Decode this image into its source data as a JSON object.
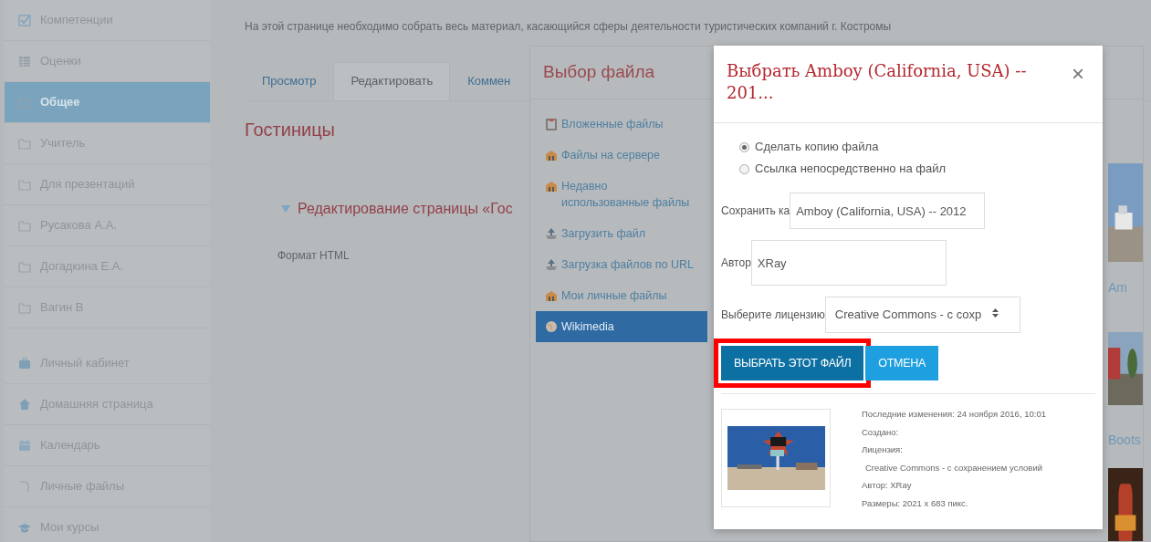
{
  "sidebar": {
    "course_items": [
      {
        "label": "Компетенции",
        "selected": false
      },
      {
        "label": "Оценки",
        "selected": false
      },
      {
        "label": "Общее",
        "selected": true
      },
      {
        "label": "Учитель",
        "selected": false
      },
      {
        "label": "Для презентаций",
        "selected": false
      },
      {
        "label": "Русакова А.А.",
        "selected": false
      },
      {
        "label": "Догадкина Е.А.",
        "selected": false
      },
      {
        "label": "Вагин В",
        "selected": false
      }
    ],
    "nav_items": [
      {
        "label": "Личный кабинет",
        "selected": false
      },
      {
        "label": "Домашняя страница",
        "selected": false
      },
      {
        "label": "Календарь",
        "selected": false
      },
      {
        "label": "Личные файлы",
        "selected": false
      },
      {
        "label": "Мои курсы",
        "selected": false
      }
    ]
  },
  "page": {
    "intro": "На этой странице необходимо собрать весь материал, касающийся сферы деятельности туристических компаний г. Костромы",
    "tabs": [
      {
        "label": "Просмотр",
        "selected": false
      },
      {
        "label": "Редактировать",
        "selected": true
      },
      {
        "label": "Коммен",
        "selected": false
      }
    ],
    "heading": "Гостиницы",
    "section": {
      "title": "Редактирование страницы «Гос",
      "expanded": true
    },
    "format_label": "Формат HTML"
  },
  "file_picker": {
    "title": "Выбор файла",
    "repositories": [
      {
        "label": "Вложенные файлы",
        "selected": false
      },
      {
        "label": "Файлы на сервере",
        "selected": false
      },
      {
        "label": "Недавно использованные файлы",
        "selected": false
      },
      {
        "label": "Загрузить файл",
        "selected": false
      },
      {
        "label": "Загрузка файлов по URL",
        "selected": false
      },
      {
        "label": "Мои личные файлы",
        "selected": false
      },
      {
        "label": "Wikimedia",
        "selected": true
      }
    ],
    "results": [
      {
        "label": "Am"
      },
      {
        "label": "Boots"
      }
    ]
  },
  "select_dialog": {
    "title": "Выбрать Amboy (California, USA) -- 201...",
    "close_label": "×",
    "options": [
      {
        "label": "Сделать копию файла",
        "selected": true
      },
      {
        "label": "Ссылка непосредственно на файл",
        "selected": false
      }
    ],
    "save_as": {
      "label": "Сохранить ка",
      "value": "Amboy (California, USA) -- 2012"
    },
    "author": {
      "label": "Автор",
      "value": "XRay"
    },
    "license": {
      "label": "Выберите лицензию",
      "value": "Creative Commons - с сохр"
    },
    "buttons": [
      {
        "label": "ВЫБРАТЬ ЭТОТ ФАЙЛ",
        "kind": "primary",
        "highlighted": true
      },
      {
        "label": "ОТМЕНА",
        "kind": "secondary",
        "highlighted": false
      }
    ],
    "details": [
      "Последние изменения: 24 ноября 2016, 10:01",
      "Создано:",
      "Лицензия:",
      "Creative Commons - с сохранением условий",
      "Автор: XRay",
      "Размеры: 2021 x 683 пикс."
    ]
  }
}
